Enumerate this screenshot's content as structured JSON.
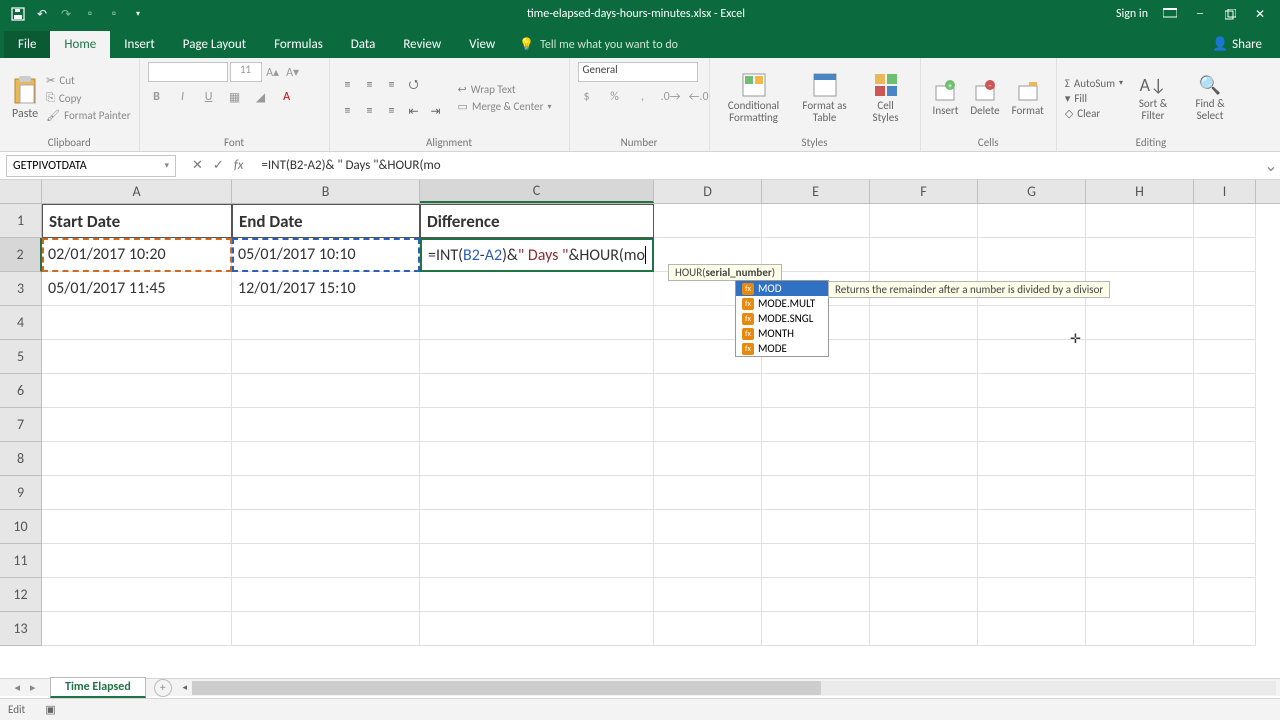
{
  "titlebar": {
    "title": "time-elapsed-days-hours-minutes.xlsx - Excel",
    "signin": "Sign in"
  },
  "tabs": {
    "file": "File",
    "home": "Home",
    "insert": "Insert",
    "layout": "Page Layout",
    "formulas": "Formulas",
    "data": "Data",
    "review": "Review",
    "view": "View",
    "tellme": "Tell me what you want to do",
    "share": "Share"
  },
  "ribbon": {
    "clipboard": {
      "paste": "Paste",
      "cut": "Cut",
      "copy": "Copy",
      "painter": "Format Painter",
      "label": "Clipboard"
    },
    "font": {
      "size": "11",
      "label": "Font"
    },
    "alignment": {
      "wrap": "Wrap Text",
      "merge": "Merge & Center",
      "label": "Alignment"
    },
    "number": {
      "general": "General",
      "label": "Number"
    },
    "styles": {
      "cond": "Conditional Formatting",
      "table": "Format as Table",
      "cell": "Cell Styles",
      "label": "Styles"
    },
    "cells": {
      "insert": "Insert",
      "delete": "Delete",
      "format": "Format",
      "label": "Cells"
    },
    "editing": {
      "autosum": "AutoSum",
      "fill": "Fill",
      "clear": "Clear",
      "sort": "Sort & Filter",
      "find": "Find & Select",
      "label": "Editing"
    }
  },
  "namebox": "GETPIVOTDATA",
  "formula_bar": "=INT(B2-A2)& \" Days \"&HOUR(mo",
  "columns": {
    "A": "A",
    "B": "B",
    "C": "C",
    "D": "D",
    "E": "E",
    "F": "F",
    "G": "G",
    "H": "H",
    "I": "I"
  },
  "widths": {
    "A": 190,
    "B": 188,
    "C": 234,
    "D": 108,
    "E": 108,
    "F": 108,
    "G": 108,
    "H": 108,
    "I": 62
  },
  "rows": [
    "1",
    "2",
    "3",
    "4",
    "5",
    "6",
    "7",
    "8",
    "9",
    "10",
    "11",
    "12",
    "13"
  ],
  "headers": {
    "A1": "Start Date",
    "B1": "End Date",
    "C1": "Difference"
  },
  "data": {
    "A2": "02/01/2017 10:20",
    "B2": "05/01/2017 10:10",
    "A3": "05/01/2017 11:45",
    "B3": "12/01/2017 15:10"
  },
  "editing_cell": {
    "pre": "=INT(",
    "ref1": "B2",
    "mid1": "-",
    "ref2": "A2",
    "mid2": ")& ",
    "str": "\" Days \"",
    "post": "&HOUR(mo"
  },
  "hint": {
    "func": "HOUR(",
    "arg": "serial_number",
    "close": ")"
  },
  "autocomplete": {
    "items": [
      "MOD",
      "MODE.MULT",
      "MODE.SNGL",
      "MONTH",
      "MODE"
    ],
    "desc": "Returns the remainder after a number is divided by a divisor"
  },
  "sheet_tab": "Time Elapsed",
  "statusbar": "Edit"
}
